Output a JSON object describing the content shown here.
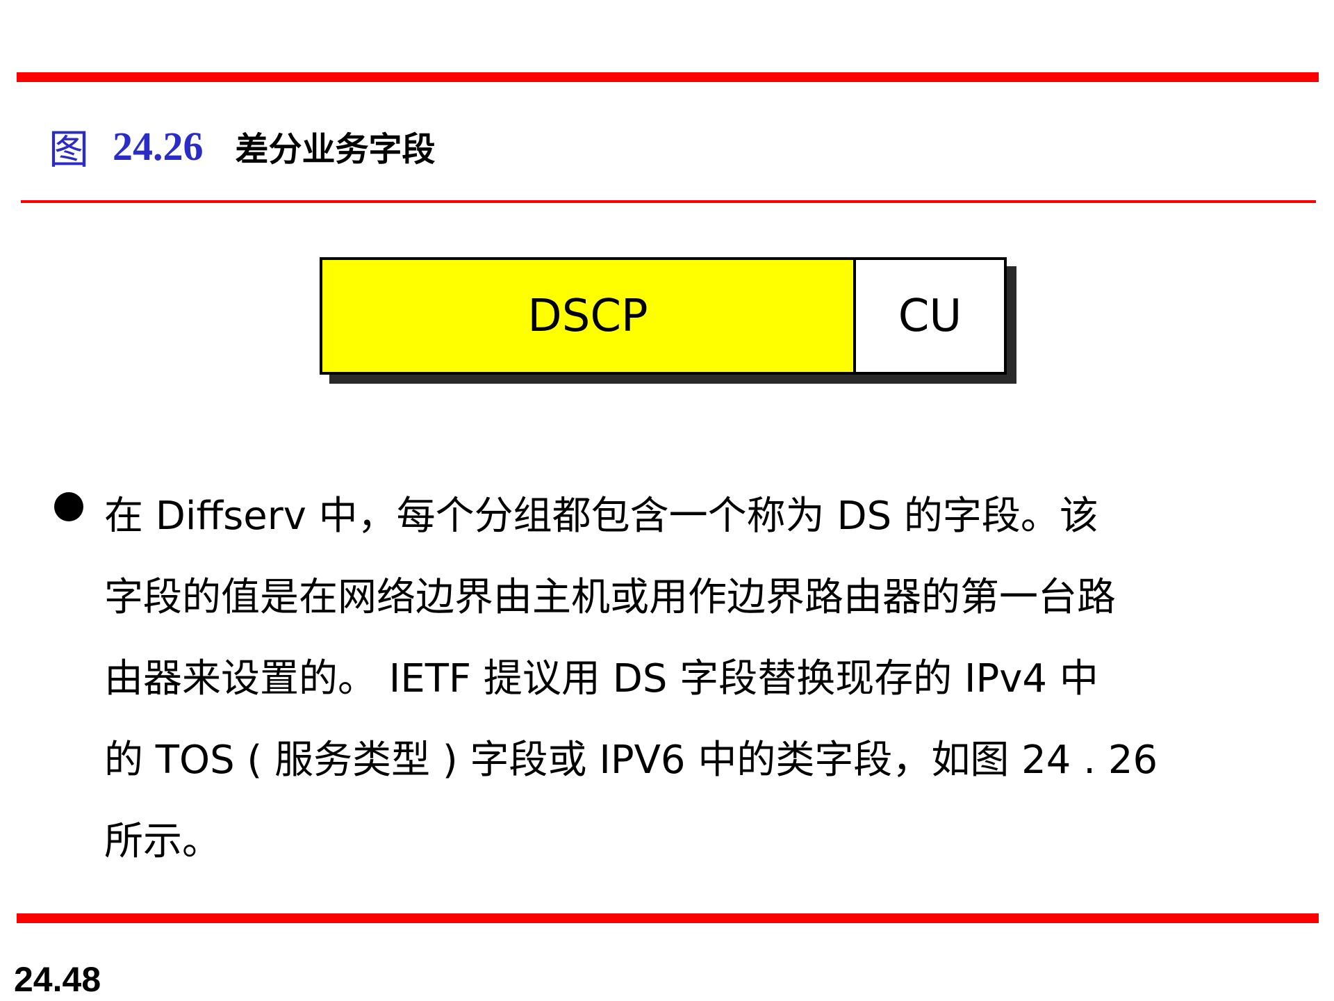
{
  "figure": {
    "label": "图",
    "number": "24.26",
    "title": "差分业务字段"
  },
  "ds_field": {
    "dscp_label": "DSCP",
    "cu_label": "CU",
    "colors": {
      "dscp_fill": "#ffff00",
      "cu_fill": "#ffffff"
    }
  },
  "bullet": {
    "lines": [
      "在 Diffserv  中，每个分组都包含一个称为 DS  的字段。该",
      "字段的值是在网络边界由主机或用作边界路由器的第一台路",
      "由器来设置的。 IETF 提议用 DS  字段替换现存的 IPv4  中",
      "的 TOS ( 服务类型 ) 字段或 IPV6  中的类字段，如图 24 . 26",
      "所示。"
    ]
  },
  "footer": {
    "page_number": "24.48"
  },
  "colors": {
    "accent_rule": "#ff0000",
    "figure_label": "#2b2bc8"
  }
}
